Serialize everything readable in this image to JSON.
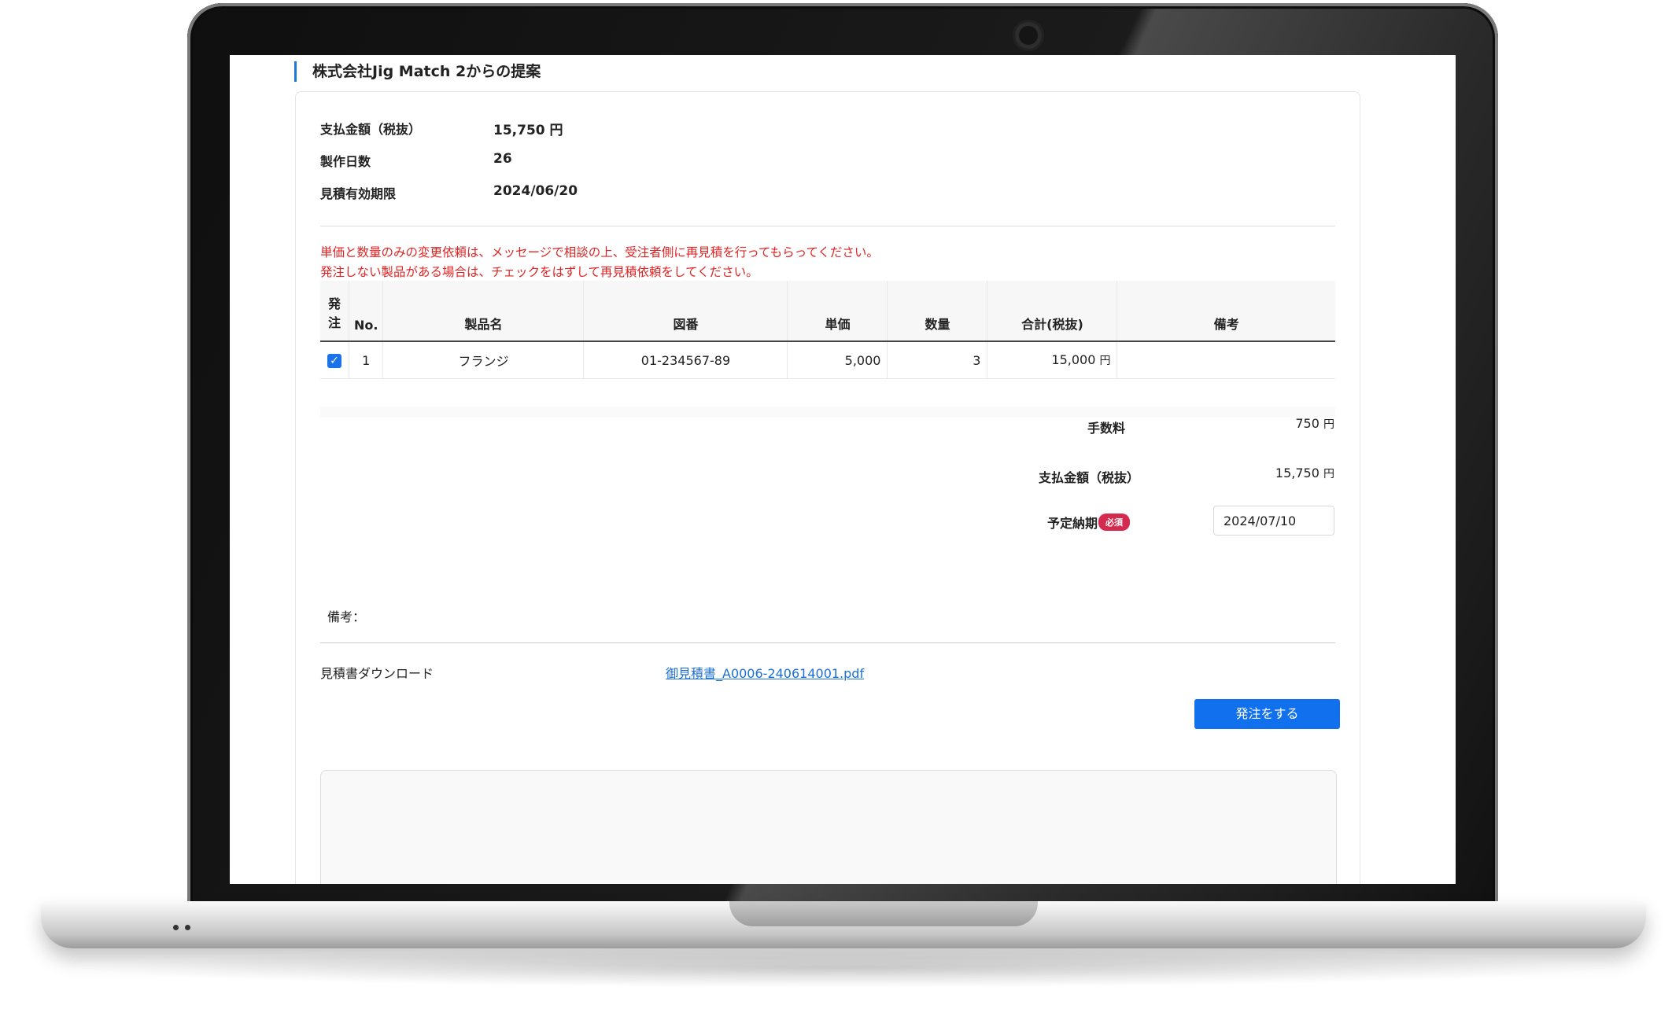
{
  "section_title": "株式会社Jig Match 2からの提案",
  "summary": {
    "rows": [
      {
        "label": "支払金額（税抜）",
        "value": "15,750 円"
      },
      {
        "label": "製作日数",
        "value": "26"
      },
      {
        "label": "見積有効期限",
        "value": "2024/06/20"
      }
    ]
  },
  "notices": [
    "単価と数量のみの変更依頼は、メッセージで相談の上、受注者側に再見積を行ってもらってください。",
    "発注しない製品がある場合は、チェックをはずして再見積依頼をしてください。"
  ],
  "table": {
    "headers": {
      "order": "発\n注",
      "no": "No.",
      "product": "製品名",
      "drawing": "図番",
      "unit_price": "単価",
      "quantity": "数量",
      "total": "合計(税抜)",
      "note": "備考"
    },
    "rows": [
      {
        "checked": true,
        "no": "1",
        "product": "フランジ",
        "drawing": "01-234567-89",
        "unit_price": "5,000",
        "quantity": "3",
        "total": "15,000",
        "currency": "円",
        "note": ""
      }
    ]
  },
  "totals": {
    "fee_label": "手数料",
    "fee_value": "750",
    "pay_label": "支払金額（税抜）",
    "pay_value": "15,750",
    "currency": "円",
    "delivery_label": "予定納期",
    "required_badge": "必須",
    "delivery_value": "2024/07/10"
  },
  "remarks_label": "備考：",
  "download": {
    "label": "見積書ダウンロード",
    "file": "御見積書_A0006-240614001.pdf"
  },
  "order_button": "発注をする",
  "colors": {
    "accent": "#1170ee",
    "notice": "#e02424",
    "badge": "#d52a4f",
    "title_bar": "#1e78d7"
  }
}
